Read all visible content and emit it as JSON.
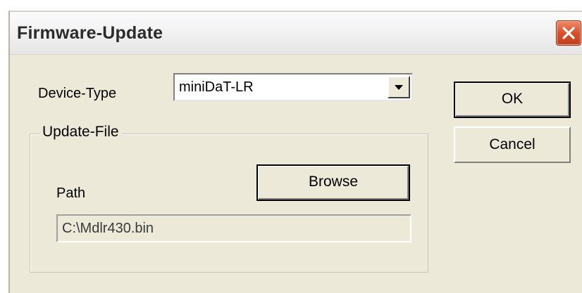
{
  "window": {
    "title": "Firmware-Update"
  },
  "device_type": {
    "label": "Device-Type",
    "selected": "miniDaT-LR"
  },
  "buttons": {
    "ok": "OK",
    "cancel": "Cancel",
    "browse": "Browse"
  },
  "update_file": {
    "group_label": "Update-File",
    "path_label": "Path",
    "path_value": "C:\\Mdlr430.bin"
  },
  "colors": {
    "dialog_bg": "#ece9d8",
    "close_button": "#d9502a"
  }
}
